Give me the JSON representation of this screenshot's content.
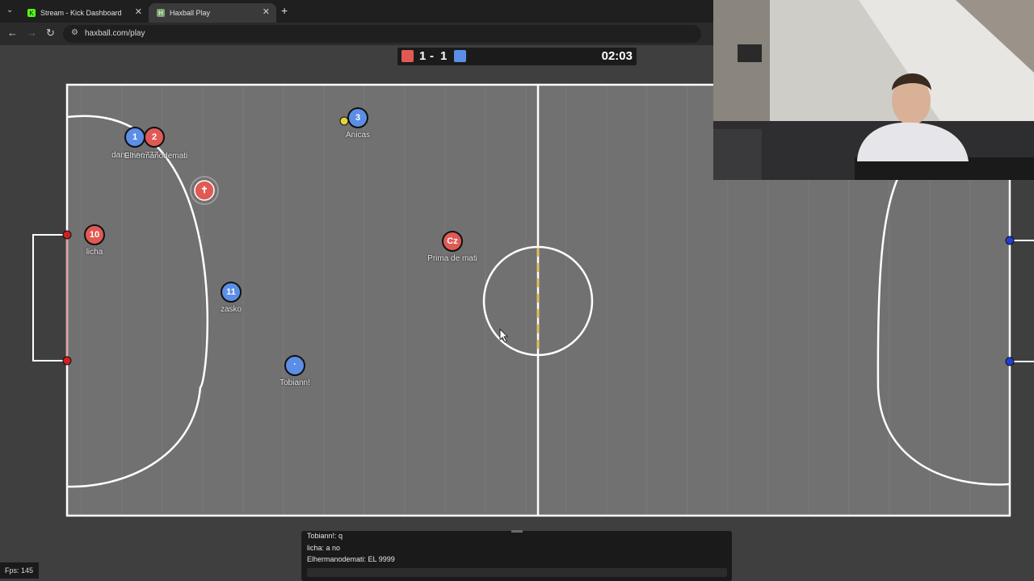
{
  "browser": {
    "tabs": [
      {
        "title": "Stream - Kick Dashboard",
        "favicon": "kick-icon",
        "active": false
      },
      {
        "title": "Haxball Play",
        "favicon": "haxball-icon",
        "active": true
      }
    ],
    "new_tab_symbol": "+",
    "url": "haxball.com/play"
  },
  "scoreboard": {
    "red_score": "1",
    "separator": "-",
    "blue_score": "1",
    "time": "02:03",
    "red_color": "#e05a55",
    "blue_color": "#5b8ee6"
  },
  "players": [
    {
      "name": "danonino777",
      "number": "1",
      "team": "blue"
    },
    {
      "name": "Elhermanodemati",
      "number": "2",
      "team": "red"
    },
    {
      "name": "Anicas",
      "number": "3",
      "team": "blue"
    },
    {
      "name": "",
      "number": "✝",
      "team": "red"
    },
    {
      "name": "licha",
      "number": "10",
      "team": "red"
    },
    {
      "name": "Prima de mati",
      "number": "Cz",
      "team": "red"
    },
    {
      "name": "zasko",
      "number": "11",
      "team": "blue"
    },
    {
      "name": "Tobiann!",
      "number": "·",
      "team": "blue"
    }
  ],
  "chat": {
    "messages": [
      "Tobiann!: q",
      "licha: a no",
      "Elhermanodemati: EL 9999"
    ]
  },
  "fps": "Fps: 145"
}
